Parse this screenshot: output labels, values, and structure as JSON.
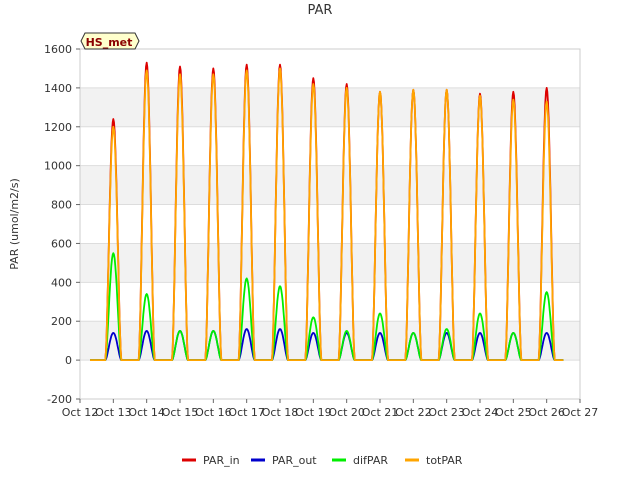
{
  "chart_data": {
    "type": "line",
    "title": "PAR",
    "ylabel": "PAR (umol/m2/s)",
    "xlabel": "",
    "badge": "HS_met",
    "ylim": [
      -200,
      1600
    ],
    "xlim": [
      12,
      27
    ],
    "yticks": [
      -200,
      0,
      200,
      400,
      600,
      800,
      1000,
      1200,
      1400,
      1600
    ],
    "xticks": [
      {
        "value": 12,
        "label": "Oct 12"
      },
      {
        "value": 13,
        "label": "Oct 13"
      },
      {
        "value": 14,
        "label": "Oct 14"
      },
      {
        "value": 15,
        "label": "Oct 15"
      },
      {
        "value": 16,
        "label": "Oct 16"
      },
      {
        "value": 17,
        "label": "Oct 17"
      },
      {
        "value": 18,
        "label": "Oct 18"
      },
      {
        "value": 19,
        "label": "Oct 19"
      },
      {
        "value": 20,
        "label": "Oct 20"
      },
      {
        "value": 21,
        "label": "Oct 21"
      },
      {
        "value": 22,
        "label": "Oct 22"
      },
      {
        "value": 23,
        "label": "Oct 23"
      },
      {
        "value": 24,
        "label": "Oct 24"
      },
      {
        "value": 25,
        "label": "Oct 25"
      },
      {
        "value": 26,
        "label": "Oct 26"
      },
      {
        "value": 27,
        "label": "Oct 27"
      }
    ],
    "grid": "horizontal bands",
    "legend_position": "bottom",
    "data_range": [
      12.3,
      26.5
    ],
    "series": [
      {
        "name": "PAR_in",
        "color": "#dd0000",
        "daily_peaks": [
          {
            "day": 13.0,
            "value": 1240
          },
          {
            "day": 14.0,
            "value": 1530
          },
          {
            "day": 15.0,
            "value": 1510
          },
          {
            "day": 16.0,
            "value": 1500
          },
          {
            "day": 17.0,
            "value": 1520
          },
          {
            "day": 18.0,
            "value": 1520
          },
          {
            "day": 19.0,
            "value": 1450
          },
          {
            "day": 20.0,
            "value": 1420
          },
          {
            "day": 21.0,
            "value": 1380
          },
          {
            "day": 22.0,
            "value": 1390
          },
          {
            "day": 23.0,
            "value": 1390
          },
          {
            "day": 24.0,
            "value": 1370
          },
          {
            "day": 25.0,
            "value": 1380
          },
          {
            "day": 26.0,
            "value": 1400
          }
        ]
      },
      {
        "name": "PAR_out",
        "color": "#0000cc",
        "daily_peaks": [
          {
            "day": 13.0,
            "value": 140
          },
          {
            "day": 14.0,
            "value": 150
          },
          {
            "day": 15.0,
            "value": 150
          },
          {
            "day": 16.0,
            "value": 150
          },
          {
            "day": 17.0,
            "value": 160
          },
          {
            "day": 18.0,
            "value": 160
          },
          {
            "day": 19.0,
            "value": 140
          },
          {
            "day": 20.0,
            "value": 140
          },
          {
            "day": 21.0,
            "value": 140
          },
          {
            "day": 22.0,
            "value": 140
          },
          {
            "day": 23.0,
            "value": 140
          },
          {
            "day": 24.0,
            "value": 140
          },
          {
            "day": 25.0,
            "value": 140
          },
          {
            "day": 26.0,
            "value": 140
          }
        ]
      },
      {
        "name": "difPAR",
        "color": "#00ee00",
        "daily_peaks": [
          {
            "day": 13.0,
            "value": 550
          },
          {
            "day": 14.0,
            "value": 340
          },
          {
            "day": 15.0,
            "value": 150
          },
          {
            "day": 16.0,
            "value": 150
          },
          {
            "day": 17.0,
            "value": 420
          },
          {
            "day": 18.0,
            "value": 380
          },
          {
            "day": 19.0,
            "value": 220
          },
          {
            "day": 20.0,
            "value": 150
          },
          {
            "day": 21.0,
            "value": 240
          },
          {
            "day": 22.0,
            "value": 140
          },
          {
            "day": 23.0,
            "value": 160
          },
          {
            "day": 24.0,
            "value": 240
          },
          {
            "day": 25.0,
            "value": 140
          },
          {
            "day": 26.0,
            "value": 350
          }
        ]
      },
      {
        "name": "totPAR",
        "color": "#ffa500",
        "daily_peaks": [
          {
            "day": 13.0,
            "value": 1200
          },
          {
            "day": 14.0,
            "value": 1490
          },
          {
            "day": 15.0,
            "value": 1470
          },
          {
            "day": 16.0,
            "value": 1470
          },
          {
            "day": 17.0,
            "value": 1490
          },
          {
            "day": 18.0,
            "value": 1500
          },
          {
            "day": 19.0,
            "value": 1420
          },
          {
            "day": 20.0,
            "value": 1400
          },
          {
            "day": 21.0,
            "value": 1380
          },
          {
            "day": 22.0,
            "value": 1390
          },
          {
            "day": 23.0,
            "value": 1390
          },
          {
            "day": 24.0,
            "value": 1360
          },
          {
            "day": 25.0,
            "value": 1340
          },
          {
            "day": 26.0,
            "value": 1330
          }
        ]
      }
    ]
  }
}
